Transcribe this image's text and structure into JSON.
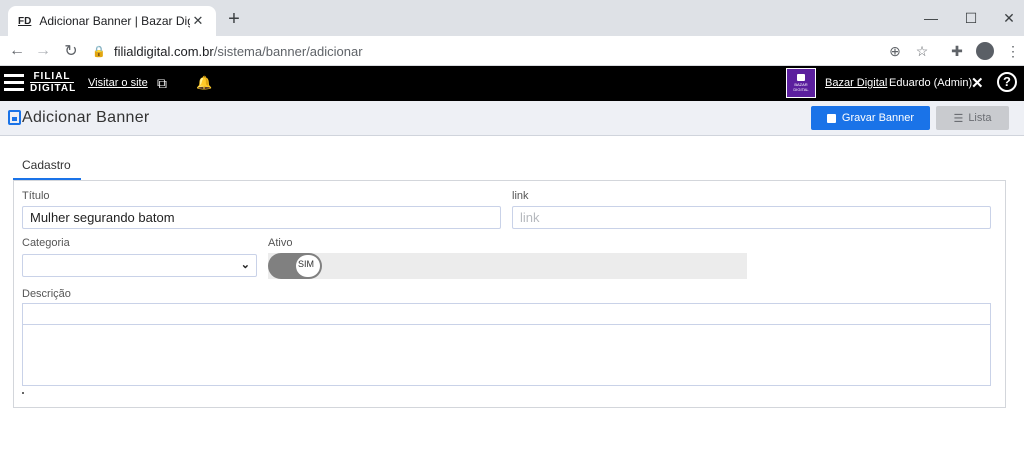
{
  "browser": {
    "tab_favicon": "FD",
    "tab_title": "Adicionar Banner | Bazar Digital",
    "url_host": "filialdigital.com.br",
    "url_path": "/sistema/banner/adicionar"
  },
  "header": {
    "logo_line1": "FILIAL",
    "logo_line2": "DIGITAL",
    "visit_link": "Visitar o site",
    "store_badge_text": "BAZAR DIGITAL",
    "store_link": "Bazar Digital",
    "user": "Eduardo (Admin)",
    "help": "?"
  },
  "page": {
    "title": "Adicionar Banner",
    "save_button": "Gravar Banner",
    "list_button": "Lista"
  },
  "form": {
    "tab": "Cadastro",
    "titulo_label": "Título",
    "titulo_value": "Mulher segurando batom",
    "link_label": "link",
    "link_placeholder": "link",
    "categoria_label": "Categoria",
    "categoria_value": "",
    "ativo_label": "Ativo",
    "ativo_value": "SIM",
    "descricao_label": "Descrição"
  },
  "colors": {
    "primary": "#1a73e8",
    "header_bg": "#000000",
    "store_badge": "#5b1f9e"
  }
}
